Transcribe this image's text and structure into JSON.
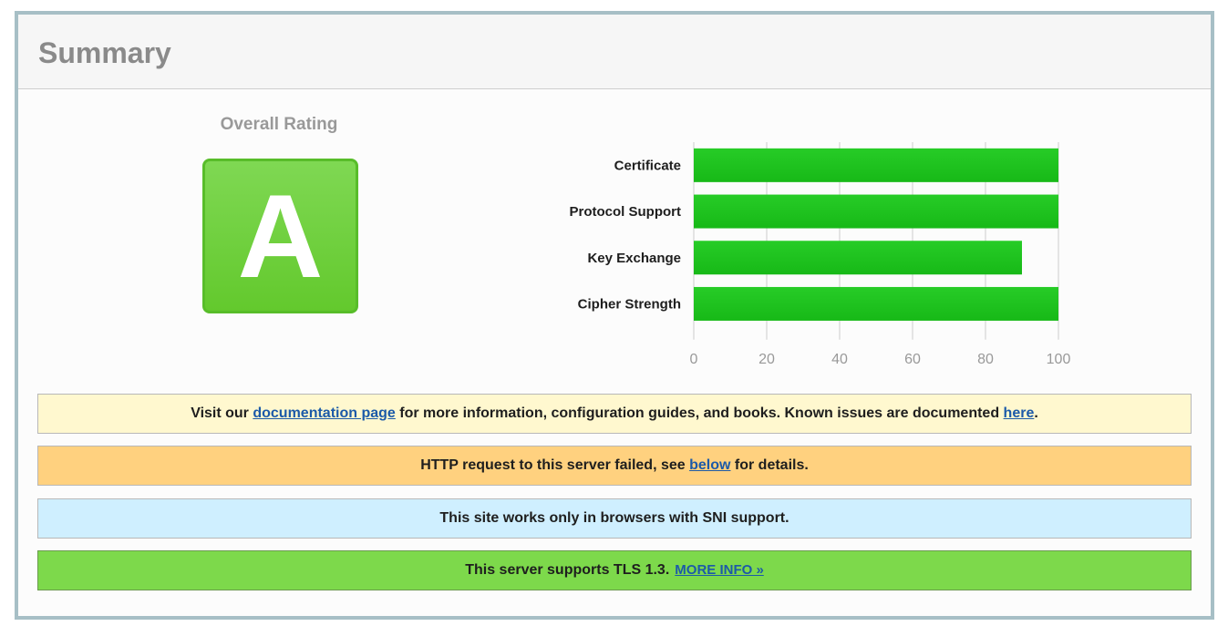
{
  "header": {
    "title": "Summary"
  },
  "rating": {
    "label": "Overall Rating",
    "grade": "A",
    "grade_color": "#6ccf3c"
  },
  "chart_data": {
    "type": "bar",
    "orientation": "horizontal",
    "categories": [
      "Certificate",
      "Protocol Support",
      "Key Exchange",
      "Cipher Strength"
    ],
    "values": [
      100,
      100,
      90,
      100
    ],
    "xlim": [
      0,
      100
    ],
    "xticks": [
      0,
      20,
      40,
      60,
      80,
      100
    ],
    "grid": true,
    "bar_color": "#17b917"
  },
  "notices": {
    "docs": {
      "text_before": "Visit our ",
      "link1": "documentation page",
      "text_middle": " for more information, configuration guides, and books. Known issues are documented ",
      "link2": "here",
      "text_after": "."
    },
    "http": {
      "text_before": "HTTP request to this server failed, see ",
      "link": "below",
      "text_after": " for details."
    },
    "sni": {
      "text": "This site works only in browsers with SNI support."
    },
    "tls": {
      "text": "This server supports TLS 1.3.",
      "link": "MORE INFO »"
    }
  },
  "colors": {
    "docs_bg": "#fff8cf",
    "http_bg": "#ffd17f",
    "sni_bg": "#cfefff",
    "tls_bg": "#7dd94b",
    "link": "#1c5aa8"
  }
}
